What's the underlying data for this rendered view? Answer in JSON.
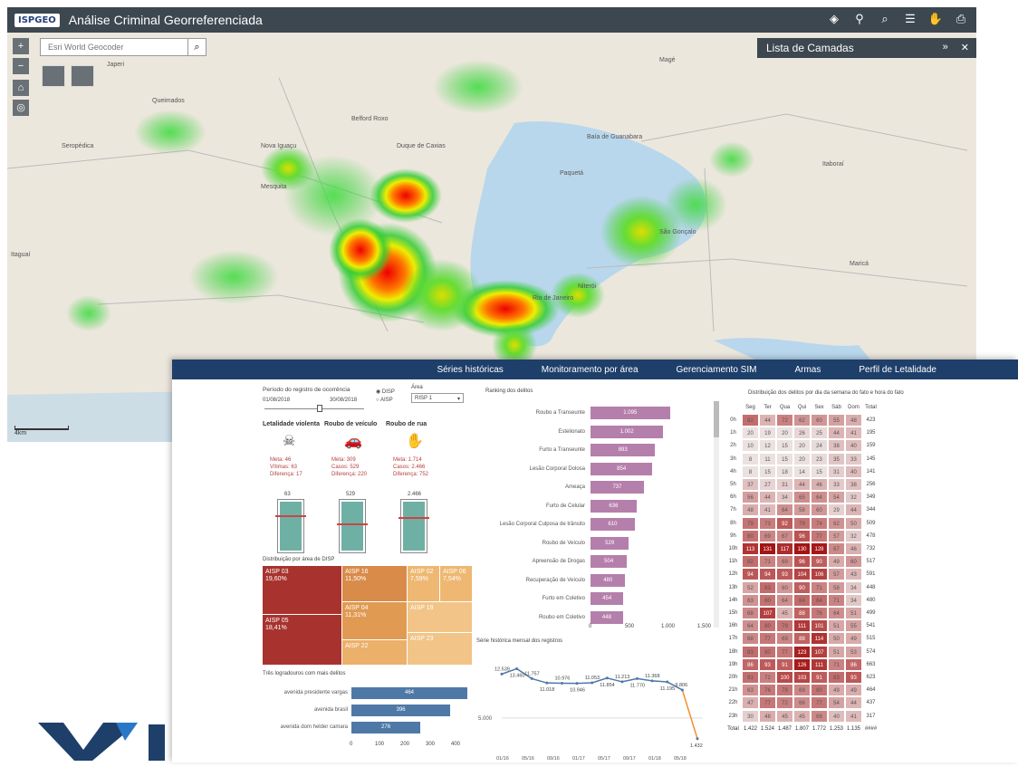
{
  "map": {
    "logo": "ISPGEO",
    "title": "Análise Criminal Georreferenciada",
    "search_placeholder": "Esri World Geocoder",
    "layers_panel_title": "Lista de Camadas",
    "scale": "4km",
    "places": [
      "Queimados",
      "Seropédica",
      "Nova Iguaçu",
      "Mesquita",
      "Duque de Caxias",
      "Belford Roxo",
      "São Gonçalo",
      "Niterói",
      "Rio de Janeiro",
      "Magé",
      "Itaboraí",
      "Maricá",
      "Baía de Guanabara",
      "Paquetá",
      "Itaguaí",
      "Japeri"
    ]
  },
  "nav": [
    "Séries históricas",
    "Monitoramento por área",
    "Gerenciamento SIM",
    "Armas",
    "Perfil de Letalidade"
  ],
  "filters": {
    "period_label": "Período do registro de ocorrência",
    "date_start": "01/08/2018",
    "date_end": "30/08/2018",
    "radio_1": "DISP",
    "radio_2": "AISP",
    "area_label": "Área",
    "area_value": "RISP 1"
  },
  "indicators": [
    {
      "title": "Letalidade violenta",
      "meta": "Meta: 46",
      "casos": "Vítimas: 63",
      "diff": "Diferença: 17",
      "value": "63",
      "fill": 1.0,
      "target": 0.73
    },
    {
      "title": "Roubo de veículo",
      "meta": "Meta: 309",
      "casos": "Casos: 529",
      "diff": "Diferença: 220",
      "value": "529",
      "fill": 1.0,
      "target": 0.58
    },
    {
      "title": "Roubo de rua",
      "meta": "Meta: 1.714",
      "casos": "Casos: 2.466",
      "diff": "Diferença: 752",
      "value": "2.466",
      "fill": 1.0,
      "target": 0.7
    }
  ],
  "treemap": {
    "title": "Distribuição por área de DISP",
    "cells": [
      {
        "label": "AISP 03",
        "pct": "19,60%",
        "color": "#a8332e"
      },
      {
        "label": "AISP 05",
        "pct": "18,41%",
        "color": "#a8332e"
      },
      {
        "label": "AISP 16",
        "pct": "11,50%",
        "color": "#d98b4a"
      },
      {
        "label": "AISP 04",
        "pct": "11,31%",
        "color": "#e09a52"
      },
      {
        "label": "AISP 22",
        "pct": "",
        "color": "#ebb06a"
      },
      {
        "label": "AISP 02",
        "pct": "7,59%",
        "color": "#eeb872"
      },
      {
        "label": "AISP 06",
        "pct": "7,54%",
        "color": "#eeb872"
      },
      {
        "label": "AISP 19",
        "pct": "",
        "color": "#f2c487"
      },
      {
        "label": "AISP 23",
        "pct": "",
        "color": "#f2c487"
      }
    ]
  },
  "streets": {
    "title": "Três logradouros com mais delitos",
    "items": [
      {
        "label": "avenida presidente vargas",
        "value": "464"
      },
      {
        "label": "avenida brasil",
        "value": "396"
      },
      {
        "label": "avenida dom helder camara",
        "value": "276"
      }
    ],
    "ticks": [
      "0",
      "100",
      "200",
      "300",
      "400"
    ]
  },
  "ranking": {
    "title": "Ranking dos delitos",
    "items": [
      {
        "label": "Roubo a Transeunte",
        "value": "1.095"
      },
      {
        "label": "Estelionato",
        "value": "1.002"
      },
      {
        "label": "Furto a Transeunte",
        "value": "893"
      },
      {
        "label": "Lesão Corporal Dolosa",
        "value": "854"
      },
      {
        "label": "Ameaça",
        "value": "737"
      },
      {
        "label": "Furto de Celular",
        "value": "636"
      },
      {
        "label": "Lesão Corporal Culposa de trânsito",
        "value": "610"
      },
      {
        "label": "Roubo de Veículo",
        "value": "529"
      },
      {
        "label": "Apreensão de Drogas",
        "value": "504"
      },
      {
        "label": "Recuperação de Veículo",
        "value": "480"
      },
      {
        "label": "Furto em Coletivo",
        "value": "454"
      },
      {
        "label": "Roubo em Coletivo",
        "value": "448"
      }
    ],
    "ticks": [
      "0",
      "500",
      "1.000",
      "1.500"
    ]
  },
  "series": {
    "title": "Série histórica mensal dos registros",
    "ytick": "5.000",
    "xticks": [
      "01/16",
      "05/16",
      "09/16",
      "01/17",
      "05/17",
      "09/17",
      "01/18",
      "05/18"
    ],
    "labels": [
      "12.539",
      "13.460",
      "11.757",
      "11.018",
      "10.976",
      "10.946",
      "11.053",
      "11.854",
      "11.213",
      "11.770",
      "11.368",
      "11.195",
      "9.806",
      "1.432"
    ]
  },
  "chart_data": {
    "type": "line",
    "title": "Série histórica mensal dos registros",
    "x": [
      "01/16",
      "02/16",
      "03/16",
      "04/16",
      "05/16",
      "06/16",
      "07/16",
      "08/16",
      "09/16",
      "10/16",
      "11/16",
      "12/16",
      "01/17",
      "02/17"
    ],
    "values": [
      12539,
      13460,
      11757,
      11018,
      10976,
      10946,
      11053,
      11854,
      11213,
      11770,
      11368,
      11195,
      9806,
      1432
    ]
  },
  "heatmap": {
    "title": "Distribuição dos delitos por dia da semana do fato e hora do fato",
    "days": [
      "Seg",
      "Ter",
      "Qua",
      "Qui",
      "Sex",
      "Sáb",
      "Dom",
      "Total"
    ],
    "rows": [
      [
        "0h",
        "82",
        "44",
        "72",
        "62",
        "60",
        "55",
        "48",
        "423"
      ],
      [
        "1h",
        "20",
        "19",
        "20",
        "26",
        "25",
        "44",
        "41",
        "195"
      ],
      [
        "2h",
        "10",
        "12",
        "15",
        "20",
        "24",
        "38",
        "40",
        "159"
      ],
      [
        "3h",
        "8",
        "11",
        "15",
        "20",
        "23",
        "35",
        "33",
        "145"
      ],
      [
        "4h",
        "8",
        "15",
        "18",
        "14",
        "15",
        "31",
        "40",
        "141"
      ],
      [
        "5h",
        "37",
        "27",
        "31",
        "44",
        "46",
        "33",
        "38",
        "256"
      ],
      [
        "6h",
        "56",
        "44",
        "34",
        "65",
        "64",
        "54",
        "32",
        "349"
      ],
      [
        "7h",
        "48",
        "41",
        "64",
        "58",
        "60",
        "29",
        "44",
        "344"
      ],
      [
        "8h",
        "79",
        "73",
        "92",
        "79",
        "74",
        "62",
        "50",
        "509"
      ],
      [
        "9h",
        "80",
        "69",
        "67",
        "96",
        "77",
        "57",
        "32",
        "478"
      ],
      [
        "10h",
        "113",
        "131",
        "117",
        "130",
        "128",
        "67",
        "46",
        "732"
      ],
      [
        "11h",
        "82",
        "71",
        "69",
        "96",
        "90",
        "49",
        "60",
        "517"
      ],
      [
        "12h",
        "94",
        "94",
        "93",
        "104",
        "106",
        "57",
        "43",
        "591"
      ],
      [
        "13h",
        "52",
        "83",
        "60",
        "90",
        "71",
        "58",
        "34",
        "448"
      ],
      [
        "14h",
        "63",
        "80",
        "64",
        "84",
        "84",
        "71",
        "34",
        "480"
      ],
      [
        "15h",
        "68",
        "107",
        "45",
        "88",
        "76",
        "64",
        "51",
        "499"
      ],
      [
        "16h",
        "64",
        "80",
        "79",
        "111",
        "101",
        "51",
        "55",
        "541"
      ],
      [
        "17h",
        "68",
        "77",
        "69",
        "88",
        "114",
        "50",
        "49",
        "515"
      ],
      [
        "18h",
        "83",
        "80",
        "77",
        "123",
        "107",
        "51",
        "53",
        "574"
      ],
      [
        "19h",
        "86",
        "93",
        "91",
        "126",
        "111",
        "71",
        "86",
        "663"
      ],
      [
        "20h",
        "81",
        "72",
        "100",
        "103",
        "91",
        "83",
        "93",
        "623"
      ],
      [
        "21h",
        "63",
        "76",
        "78",
        "69",
        "80",
        "49",
        "49",
        "464"
      ],
      [
        "22h",
        "47",
        "77",
        "72",
        "66",
        "77",
        "54",
        "44",
        "437"
      ],
      [
        "23h",
        "30",
        "48",
        "45",
        "45",
        "68",
        "40",
        "41",
        "317"
      ]
    ],
    "totals": [
      "Total",
      "1.422",
      "1.524",
      "1.487",
      "1.807",
      "1.772",
      "1.253",
      "1.135",
      "####"
    ]
  }
}
